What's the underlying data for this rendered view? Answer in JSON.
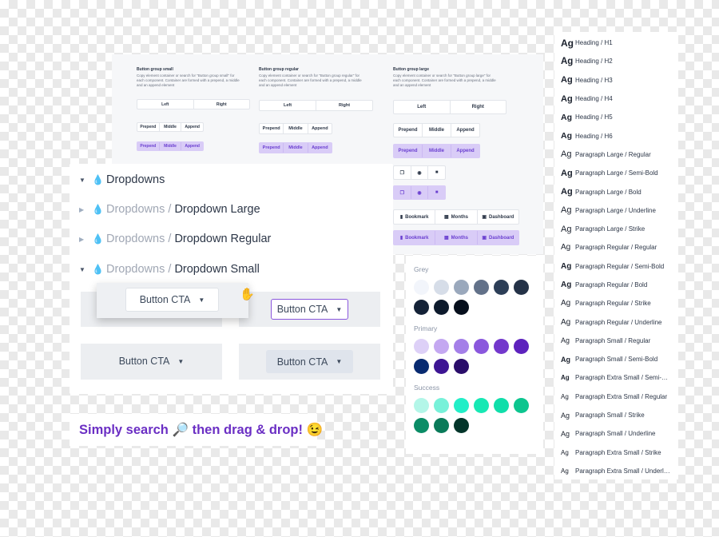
{
  "button_groups": [
    {
      "title": "Button group small",
      "desc": "Copy element container or search for \"Button group small\" for each component. Container are formed with a prepend, a middle and an append element",
      "two": [
        "Left",
        "Right"
      ],
      "three": [
        "Prepend",
        "Middle",
        "Append"
      ],
      "three_purple": [
        "Prepend",
        "Middle",
        "Append"
      ]
    },
    {
      "title": "Button group regular",
      "desc": "Copy element container or search for \"Button group regular\" for each component. Container are formed with a prepend, a middle and an append element",
      "two": [
        "Left",
        "Right"
      ],
      "three": [
        "Prepend",
        "Middle",
        "Append"
      ],
      "three_purple": [
        "Prepend",
        "Middle",
        "Append"
      ]
    },
    {
      "title": "Button group large",
      "desc": "Copy element container or search for \"Button group large\" for each component. Container are formed with a prepend, a middle and an append element",
      "two": [
        "Left",
        "Right"
      ],
      "three": [
        "Prepend",
        "Middle",
        "Append"
      ],
      "three_purple": [
        "Prepend",
        "Middle",
        "Append"
      ],
      "labeled": [
        "Bookmark",
        "Months",
        "Dashboard"
      ],
      "labeled_purple": [
        "Bookmark",
        "Months",
        "Dashboard"
      ]
    }
  ],
  "icons": {
    "bookmark": "▮",
    "calendar": "▦",
    "dashboard": "▣",
    "copy": "❐",
    "eye": "◉",
    "trash": "■"
  },
  "typography": [
    {
      "ag": "Ag",
      "label": "Heading / H1",
      "size": 12,
      "bold": true
    },
    {
      "ag": "Ag",
      "label": "Heading / H2",
      "size": 11.5,
      "bold": true
    },
    {
      "ag": "Ag",
      "label": "Heading / H3",
      "size": 11,
      "bold": true
    },
    {
      "ag": "Ag",
      "label": "Heading / H4",
      "size": 11,
      "bold": true
    },
    {
      "ag": "Ag",
      "label": "Heading / H5",
      "size": 10.5,
      "bold": true
    },
    {
      "ag": "Ag",
      "label": "Heading / H6",
      "size": 10.5,
      "bold": true
    },
    {
      "ag": "Ag",
      "label": "Paragraph Large / Regular",
      "size": 11,
      "bold": false
    },
    {
      "ag": "Ag",
      "label": "Paragraph Large / Semi-Bold",
      "size": 11,
      "bold": true
    },
    {
      "ag": "Ag",
      "label": "Paragraph Large / Bold",
      "size": 11,
      "bold": true
    },
    {
      "ag": "Ag",
      "label": "Paragraph Large / Underline",
      "size": 11,
      "bold": false
    },
    {
      "ag": "Ag",
      "label": "Paragraph Large / Strike",
      "size": 11,
      "bold": false
    },
    {
      "ag": "Ag",
      "label": "Paragraph Regular / Regular",
      "size": 10,
      "bold": false
    },
    {
      "ag": "Ag",
      "label": "Paragraph Regular / Semi-Bold",
      "size": 10,
      "bold": true
    },
    {
      "ag": "Ag",
      "label": "Paragraph Regular / Bold",
      "size": 10,
      "bold": true
    },
    {
      "ag": "Ag",
      "label": "Paragraph Regular / Strike",
      "size": 10,
      "bold": false
    },
    {
      "ag": "Ag",
      "label": "Paragraph Regular / Underline",
      "size": 10,
      "bold": false
    },
    {
      "ag": "Ag",
      "label": "Paragraph Small / Regular",
      "size": 9,
      "bold": false
    },
    {
      "ag": "Ag",
      "label": "Paragraph Small / Semi-Bold",
      "size": 9,
      "bold": true
    },
    {
      "ag": "Ag",
      "label": "Paragraph Extra Small / Semi-Bold",
      "size": 8,
      "bold": true
    },
    {
      "ag": "Ag",
      "label": "Paragraph Extra Small / Regular",
      "size": 8,
      "bold": false
    },
    {
      "ag": "Ag",
      "label": "Paragraph Small / Strike",
      "size": 9,
      "bold": false
    },
    {
      "ag": "Ag",
      "label": "Paragraph Small / Underline",
      "size": 9,
      "bold": false
    },
    {
      "ag": "Ag",
      "label": "Paragraph Extra Small / Strike",
      "size": 8,
      "bold": false
    },
    {
      "ag": "Ag",
      "label": "Paragraph Extra Small / Underline",
      "size": 8,
      "bold": false
    }
  ],
  "colors": [
    {
      "name": "Grey",
      "swatches": [
        "#f2f5fb",
        "#d6dde8",
        "#9aa8bc",
        "#627189",
        "#2c3e57",
        "#243247",
        "#142237",
        "#0d1a2c",
        "#060f1c"
      ]
    },
    {
      "name": "Primary",
      "swatches": [
        "#ddd0f7",
        "#c4a8f1",
        "#a47fe8",
        "#8a57dd",
        "#7338cc",
        "#5d22bd",
        "#082a70",
        "#3d1593",
        "#2a0d6a"
      ]
    },
    {
      "name": "Success",
      "swatches": [
        "#b3f6e8",
        "#77f1d9",
        "#22eec7",
        "#17e8b4",
        "#10deaa",
        "#0cc58f",
        "#0b8c66",
        "#0a7a59",
        "#03352a"
      ]
    }
  ],
  "dropdowns": {
    "rows": [
      {
        "muted": "",
        "text": "Dropdowns",
        "expanded": true
      },
      {
        "muted": "Dropdowns / ",
        "text": "Dropdown Large",
        "expanded": false
      },
      {
        "muted": "Dropdowns / ",
        "text": "Dropdown Regular",
        "expanded": false
      },
      {
        "muted": "Dropdowns / ",
        "text": "Dropdown Small",
        "expanded": true
      }
    ],
    "cta_labels": [
      "Button CTA",
      "Button CTA",
      "Button CTA",
      "Button CTA"
    ]
  },
  "tagline": "Simply search 🔎 then drag & drop! 😉"
}
